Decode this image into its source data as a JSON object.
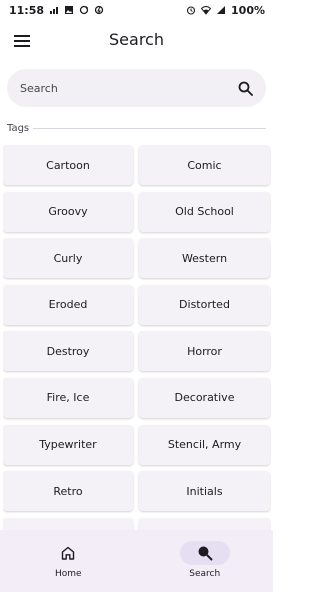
{
  "status_bar": {
    "time": "11:58",
    "battery": "100%",
    "left_icons": [
      "signal-icon",
      "image-icon",
      "sync-icon",
      "data-saver-icon"
    ],
    "right_icons": [
      "alarm-icon",
      "wifi-icon",
      "signal-strength-icon"
    ]
  },
  "app_bar": {
    "title": "Search",
    "menu_icon": "menu-icon"
  },
  "search": {
    "placeholder": "Search",
    "value": ""
  },
  "tags": {
    "label": "Tags",
    "items": [
      "Cartoon",
      "Comic",
      "Groovy",
      "Old School",
      "Curly",
      "Western",
      "Eroded",
      "Distorted",
      "Destroy",
      "Horror",
      "Fire, Ice",
      "Decorative",
      "Typewriter",
      "Stencil, Army",
      "Retro",
      "Initials",
      "",
      ""
    ]
  },
  "bottom_nav": {
    "items": [
      {
        "label": "Home",
        "icon": "home-icon",
        "active": false
      },
      {
        "label": "Search",
        "icon": "search-icon",
        "active": true
      }
    ]
  },
  "colors": {
    "background": "#ffffff",
    "search_bar": "#f2f0f5",
    "tag_button": "#f4f2f7",
    "nav_background": "#f3edf7",
    "nav_active_pill": "#e6dff2",
    "text": "#1d1b20"
  }
}
